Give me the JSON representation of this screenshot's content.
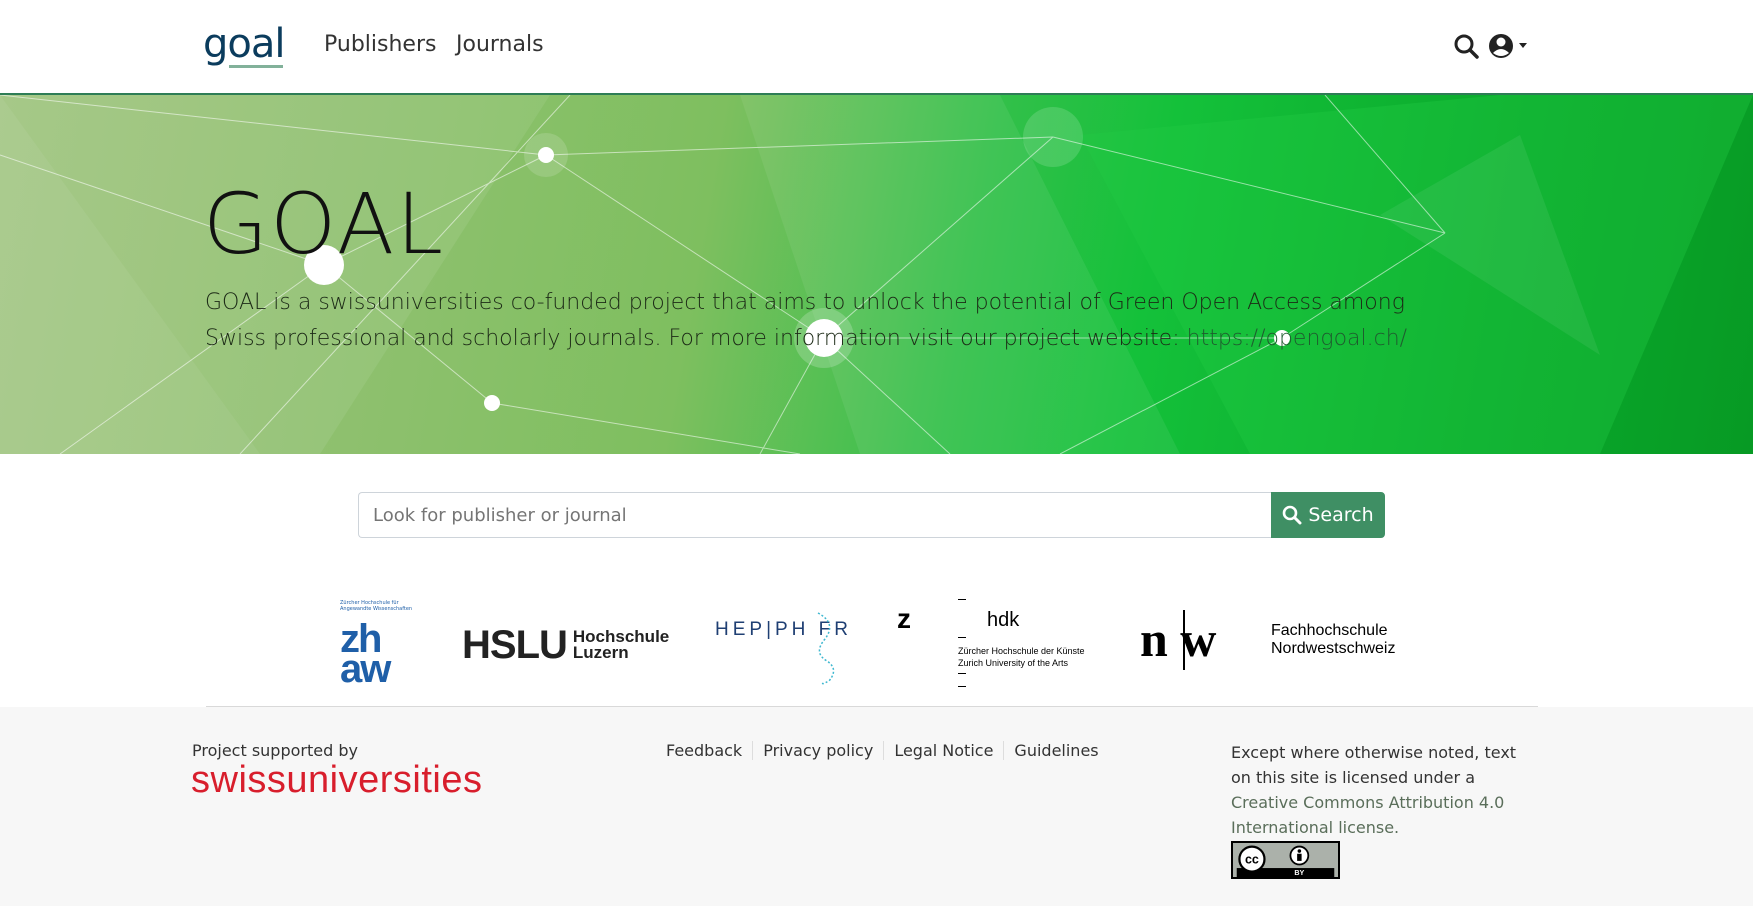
{
  "navbar": {
    "logo_text": "goal",
    "publishers_label": "Publishers",
    "journals_label": "Journals"
  },
  "hero": {
    "title": "GOAL",
    "description": "GOAL is a swissuniversities co-funded project that aims to unlock the potential of Green Open Access among Swiss professional and scholarly journals. For more information visit our project website: ",
    "link_text": "https://opengoal.ch/"
  },
  "search": {
    "placeholder": "Look for publisher or journal",
    "button_label": "Search"
  },
  "partners": {
    "zhaw_small": "Zürcher Hochschule für Angewandte Wissenschaften",
    "zhaw_big": "zh aw",
    "hslu_big": "HSLU",
    "hslu_small_1": "Hochschule",
    "hslu_small_2": "Luzern",
    "hep_text": "HEP|PH FR",
    "hdk_z": "z",
    "hdk_name": "hdk",
    "hdk_sub_1": "Zürcher Hochschule der Künste",
    "hdk_sub_2": "Zurich University of the Arts",
    "fhnw_mark": "n w",
    "fhnw_name_1": "Fachhochschule",
    "fhnw_name_2": "Nordwestschweiz"
  },
  "footer": {
    "supported_label": "Project supported by",
    "swissuniversities": "swissuniversities",
    "links": [
      "Feedback",
      "Privacy policy",
      "Legal Notice",
      "Guidelines"
    ],
    "license_prefix": "Except where otherwise noted, text on this site is licensed under a ",
    "license_link": "Creative Commons Attribution 4.0 International license.",
    "cc_badge": "cc BY"
  },
  "colors": {
    "accent_green": "#3f8f64",
    "brand_navy": "#0b3c5d",
    "swissuni_red": "#d81e2c"
  }
}
